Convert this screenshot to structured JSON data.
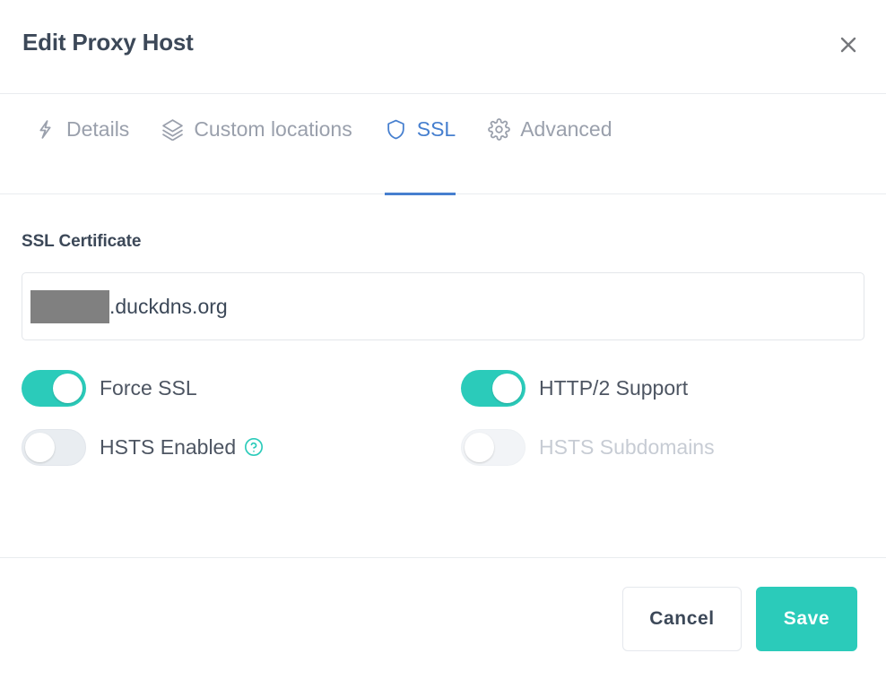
{
  "header": {
    "title": "Edit Proxy Host",
    "close_icon": "close-icon"
  },
  "tabs": [
    {
      "label": "Details",
      "icon": "zap-icon",
      "active": false
    },
    {
      "label": "Custom locations",
      "icon": "layers-icon",
      "active": false
    },
    {
      "label": "SSL",
      "icon": "shield-icon",
      "active": true
    },
    {
      "label": "Advanced",
      "icon": "gear-icon",
      "active": false
    }
  ],
  "ssl": {
    "section_title": "SSL Certificate",
    "certificate_value": ".duckdns.org",
    "certificate_redacted": true,
    "toggles": [
      {
        "label": "Force SSL",
        "state": "on",
        "disabled": false,
        "help": false
      },
      {
        "label": "HTTP/2 Support",
        "state": "on",
        "disabled": false,
        "help": false
      },
      {
        "label": "HSTS Enabled",
        "state": "off",
        "disabled": false,
        "help": true,
        "help_icon": "question-circle-icon"
      },
      {
        "label": "HSTS Subdomains",
        "state": "off",
        "disabled": true,
        "help": false
      }
    ]
  },
  "footer": {
    "cancel_label": "Cancel",
    "save_label": "Save"
  },
  "colors": {
    "accent_teal": "#2bcbba",
    "active_tab_blue": "#467fcf",
    "text_dark": "#3c4858",
    "text_muted": "#9aa0ac",
    "text_disabled": "#c7ccd4",
    "redaction_gray": "#808080",
    "border": "#e9ecef"
  }
}
